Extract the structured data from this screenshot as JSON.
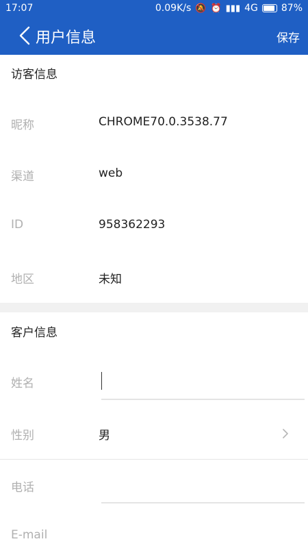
{
  "status_bar": {
    "time": "17:07",
    "speed": "0.09K/s",
    "network": "4G",
    "battery": "87%"
  },
  "app_bar": {
    "title": "用户信息",
    "save_label": "保存"
  },
  "visitor_section": {
    "title": "访客信息",
    "rows": [
      {
        "label": "昵称",
        "value": "CHROME70.0.3538.77"
      },
      {
        "label": "渠道",
        "value": "web"
      },
      {
        "label": "ID",
        "value": "958362293"
      },
      {
        "label": "地区",
        "value": "未知"
      }
    ]
  },
  "customer_section": {
    "title": "客户信息",
    "name_label": "姓名",
    "name_value": "",
    "gender_label": "性别",
    "gender_value": "男",
    "phone_label": "电话",
    "phone_value": "",
    "email_label": "E-mail"
  },
  "colors": {
    "primary": "#1f5fc4",
    "label_gray": "#b0b0b0",
    "text": "#222222",
    "band": "#f1f1f1"
  }
}
